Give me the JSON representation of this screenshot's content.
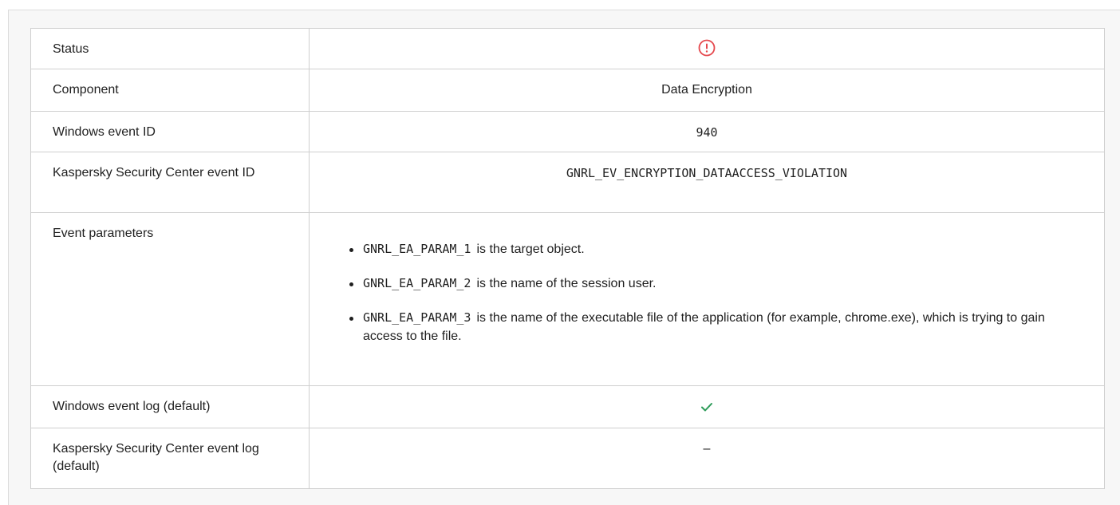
{
  "rows": {
    "status": {
      "label": "Status",
      "icon": "error-circle-icon",
      "icon_color": "#e5484d"
    },
    "component": {
      "label": "Component",
      "value": "Data Encryption"
    },
    "windows_event_id": {
      "label": "Windows event ID",
      "value": "940"
    },
    "ksc_event_id": {
      "label": "Kaspersky Security Center event ID",
      "value": "GNRL_EV_ENCRYPTION_DATAACCESS_VIOLATION"
    },
    "event_parameters": {
      "label": "Event parameters",
      "items": [
        {
          "code": "GNRL_EA_PARAM_1",
          "text": "is the target object."
        },
        {
          "code": "GNRL_EA_PARAM_2",
          "text": "is the name of the session user."
        },
        {
          "code": "GNRL_EA_PARAM_3",
          "text": "is the name of the executable file of the application (for example, chrome.exe), which is trying to gain access to the file."
        }
      ]
    },
    "windows_event_log": {
      "label": "Windows event log (default)",
      "icon": "checkmark-icon",
      "icon_color": "#2e9c5a"
    },
    "ksc_event_log": {
      "label": "Kaspersky Security Center event log (default)",
      "value": "–"
    }
  }
}
